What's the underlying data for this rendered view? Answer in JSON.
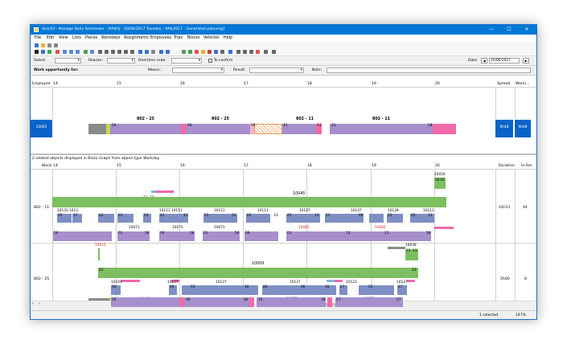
{
  "window": {
    "title": "dcsc03 - Manage Daily Schedules - [RAIEQ - 20/06/2017 Tuesday - RAIL2017 - Generated planning]",
    "controls": [
      "—",
      "☐",
      "✕"
    ]
  },
  "menu": [
    "File",
    "Edit",
    "View",
    "Lists",
    "Pieces",
    "Workdays",
    "Assignments",
    "Employees",
    "Trips",
    "Blocks",
    "Vehicles",
    "Help"
  ],
  "filter": {
    "select_label": "Select:",
    "reason_label": "Reason:",
    "overtime_label": "Overtime code:",
    "confirm_label": "To confirm",
    "date_label": "Date:",
    "date_value": "20/06/2017"
  },
  "work_opportunity": {
    "label": "Work opportunity for:",
    "means_label": "Means:",
    "result_label": "Result:",
    "note_label": "Note:"
  },
  "employee_panel": {
    "col_employee": "Employee",
    "col_spread": "Spread",
    "col_work": "Worki...",
    "employee_id": "10065",
    "spread_value": "9h48",
    "work_value": "9h48",
    "hours": [
      "14",
      "15",
      "16",
      "17",
      "18",
      "19",
      "20"
    ],
    "segment_labels": [
      "802 - 25",
      "802 - 25",
      "802 - 11",
      "802 - 11"
    ],
    "segment_nums": [
      "56",
      "06",
      "08",
      "41",
      "13",
      "21",
      "58"
    ]
  },
  "status_caption": "2 related objects displayed in Block Graph from object type Workday",
  "block_panel": {
    "col_block": "Block",
    "col_duration": "Duration",
    "col_inservice": "In-Ser",
    "hours": [
      "14",
      "15",
      "16",
      "17",
      "18",
      "19",
      "20"
    ],
    "blocks": [
      {
        "name": "802 - 11",
        "duration": "14h11",
        "inservice": "44",
        "vehicle_top": "10020",
        "vehicle_top_nums": [
          "58",
          "10"
        ],
        "green_label": "10045",
        "green_nums": [
          "33",
          "33"
        ],
        "trip_labels": [
          "10131",
          "1013",
          "10111",
          "10111",
          "10111",
          "10111",
          "10137",
          "10137",
          "10139",
          "10111"
        ],
        "mid_nums": [
          "05",
          "37",
          "41",
          "01",
          "24",
          "41",
          "13",
          "21",
          "53",
          "01",
          "33",
          "41",
          "13",
          "21",
          "09",
          "25",
          "45",
          "13"
        ],
        "duty_labels": [
          "10071",
          "10071",
          "10071",
          "10065",
          "10065"
        ],
        "bottom_nums": [
          "56",
          "01",
          "56",
          "06",
          "58",
          "01",
          "56",
          "06",
          "01",
          "53",
          "21",
          "58"
        ]
      },
      {
        "name": "802 - 25",
        "duration": "5h00",
        "inservice": "8",
        "vehicle_top": "10015",
        "vehicle_right": "10039",
        "vehicle_right_nums": [
          "31",
          "43"
        ],
        "green_label": "10009",
        "green_nums": [
          "43",
          "43"
        ],
        "trip_labels": [
          "10141",
          "10127",
          "10127",
          "10127",
          "10123",
          "10127"
        ],
        "mid_nums": [
          "56",
          "46",
          "55",
          "16",
          "46",
          "06",
          "16",
          "27",
          "55",
          "27"
        ],
        "duty_labels": [
          "10065",
          "10085",
          "10085"
        ],
        "bottom_nums": [
          "56",
          "06",
          "46",
          "16",
          "16",
          "27",
          "27"
        ]
      }
    ]
  },
  "statusbar": {
    "selected": "1 selected",
    "zoom": "147%"
  }
}
